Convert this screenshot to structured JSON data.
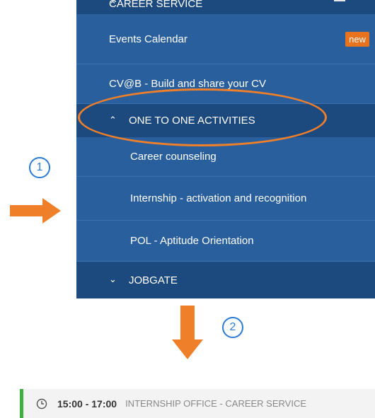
{
  "menu": {
    "header_label": "CAREER SERVICE",
    "items": [
      {
        "label": "Events Calendar",
        "badge": "new"
      },
      {
        "label": "CV@B - Build and share your CV"
      },
      {
        "label": "ONE TO ONE ACTIVITIES"
      },
      {
        "label": "Career counseling"
      },
      {
        "label": "Internship - activation and recognition"
      },
      {
        "label": "POL - Aptitude Orientation"
      },
      {
        "label": "JOBGATE"
      }
    ]
  },
  "annotations": {
    "step1": "1",
    "step2": "2"
  },
  "event": {
    "time": "15:00 - 17:00",
    "location": "INTERNSHIP OFFICE - CAREER SERVICE"
  },
  "colors": {
    "menu_bg": "#2a5f9e",
    "menu_dark": "#1d4a7e",
    "accent_orange": "#f07f2a",
    "step_blue": "#2b7bd3",
    "event_green": "#3fae40"
  }
}
